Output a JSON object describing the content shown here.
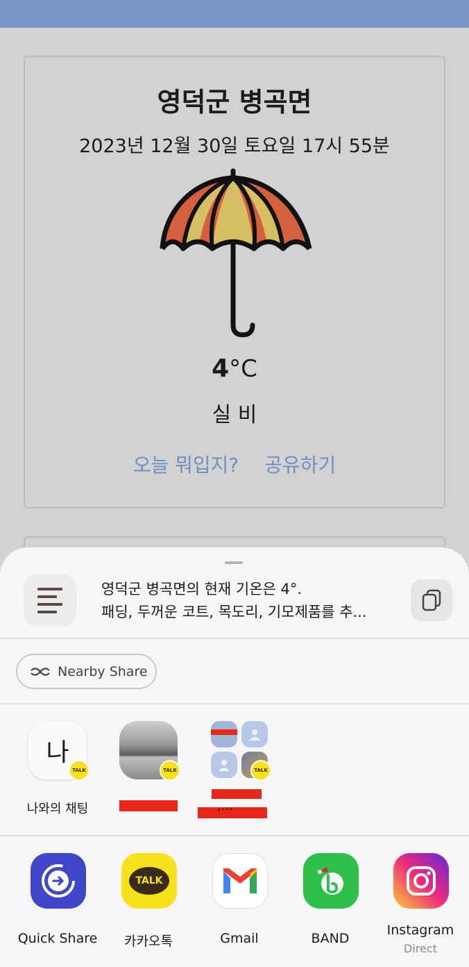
{
  "weather": {
    "location": "영덕군 병곡면",
    "datetime": "2023년 12월 30일 토요일 17시 55분",
    "weather_icon": "umbrella-icon",
    "temp_value": "4",
    "temp_unit": "°C",
    "condition": "실 비",
    "action_outfit": "오늘 뭐입지?",
    "action_share": "공유하기"
  },
  "share_sheet": {
    "preview_line1": "영덕군 병곡면의 현재 기온은 4°.",
    "preview_line2": "패딩, 두꺼운 코트, 목도리, 기모제품를 추...",
    "nearby_share_label": "Nearby Share",
    "contacts": [
      {
        "avatar_text": "나",
        "label": "나와의 채팅",
        "badge": "TALK"
      },
      {
        "avatar_text": "",
        "label": "",
        "badge": "TALK"
      },
      {
        "avatar_text": "",
        "label": ",...",
        "badge": "TALK"
      }
    ],
    "apps": [
      {
        "label": "Quick Share",
        "icon": "quick-share-icon",
        "color": "#3f46c8"
      },
      {
        "label": "카카오톡",
        "icon": "kakaotalk-icon",
        "color": "#f7e11a",
        "icon_text": "TALK"
      },
      {
        "label": "Gmail",
        "icon": "gmail-icon",
        "color": "#ffffff"
      },
      {
        "label": "BAND",
        "icon": "band-icon",
        "color": "#2ec04b"
      },
      {
        "label": "Instagram",
        "sublabel": "Direct",
        "icon": "instagram-icon",
        "color": "#d62976"
      }
    ]
  },
  "colors": {
    "status_bar": "#7a98c7",
    "background": "#d2d2d2",
    "link": "#6f8fc0",
    "sheet": "#f6f6f8"
  }
}
